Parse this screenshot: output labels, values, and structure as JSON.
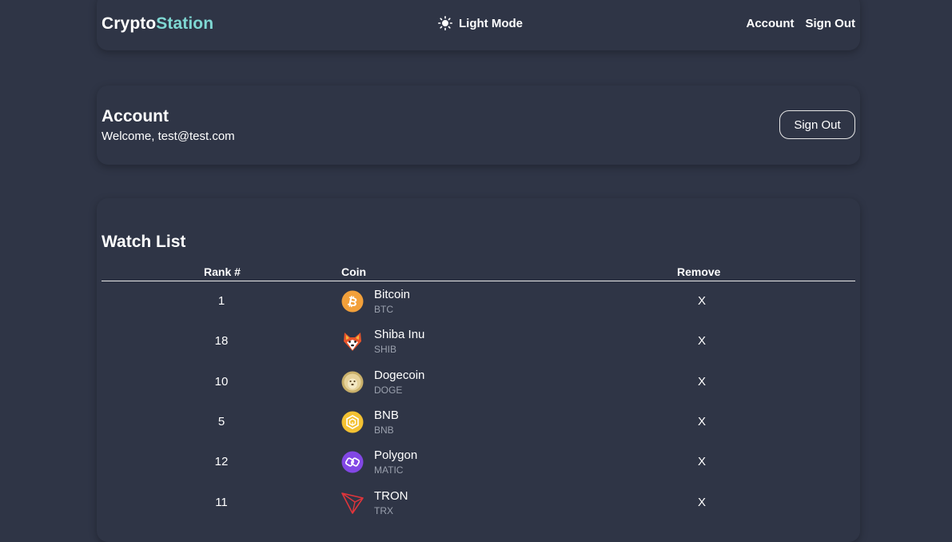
{
  "navbar": {
    "brand_part1": "Crypto",
    "brand_part2": "Station",
    "mode_label": "Light Mode",
    "account_link": "Account",
    "signout_link": "Sign Out"
  },
  "account": {
    "title": "Account",
    "welcome": "Welcome, test@test.com",
    "signout_button": "Sign Out"
  },
  "watchlist": {
    "title": "Watch List",
    "columns": {
      "rank": "Rank #",
      "coin": "Coin",
      "remove": "Remove"
    },
    "remove_symbol": "X",
    "rows": [
      {
        "rank": "1",
        "name": "Bitcoin",
        "symbol": "BTC",
        "icon": "bitcoin-icon"
      },
      {
        "rank": "18",
        "name": "Shiba Inu",
        "symbol": "SHIB",
        "icon": "shiba-inu-icon"
      },
      {
        "rank": "10",
        "name": "Dogecoin",
        "symbol": "DOGE",
        "icon": "dogecoin-icon"
      },
      {
        "rank": "5",
        "name": "BNB",
        "symbol": "BNB",
        "icon": "bnb-icon"
      },
      {
        "rank": "12",
        "name": "Polygon",
        "symbol": "MATIC",
        "icon": "polygon-icon"
      },
      {
        "rank": "11",
        "name": "TRON",
        "symbol": "TRX",
        "icon": "tron-icon"
      }
    ]
  },
  "colors": {
    "background": "#2f3546",
    "accent": "#7fd8d3",
    "muted_text": "#9aa0ad"
  }
}
